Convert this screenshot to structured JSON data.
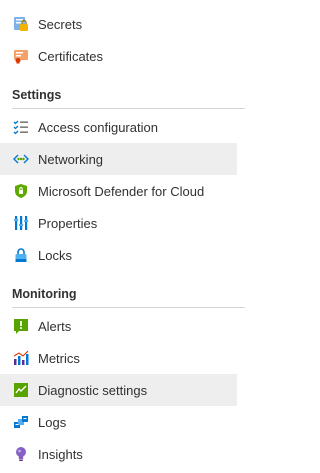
{
  "nav": {
    "top_items": [
      {
        "label": "Secrets",
        "icon": "key-vault-secret-icon"
      },
      {
        "label": "Certificates",
        "icon": "certificate-icon"
      }
    ],
    "sections": [
      {
        "title": "Settings",
        "items": [
          {
            "label": "Access configuration",
            "icon": "checklist-icon"
          },
          {
            "label": "Networking",
            "icon": "networking-icon",
            "highlighted": true
          },
          {
            "label": "Microsoft Defender for Cloud",
            "icon": "defender-shield-icon"
          },
          {
            "label": "Properties",
            "icon": "properties-icon"
          },
          {
            "label": "Locks",
            "icon": "lock-icon"
          }
        ]
      },
      {
        "title": "Monitoring",
        "items": [
          {
            "label": "Alerts",
            "icon": "alerts-icon"
          },
          {
            "label": "Metrics",
            "icon": "metrics-icon"
          },
          {
            "label": "Diagnostic settings",
            "icon": "diagnostic-settings-icon",
            "highlighted": true
          },
          {
            "label": "Logs",
            "icon": "logs-icon"
          },
          {
            "label": "Insights",
            "icon": "insights-bulb-icon"
          }
        ]
      }
    ]
  },
  "colors": {
    "highlight_bg": "#eeeeee",
    "text": "#323130",
    "divider": "#d6d6d6"
  }
}
